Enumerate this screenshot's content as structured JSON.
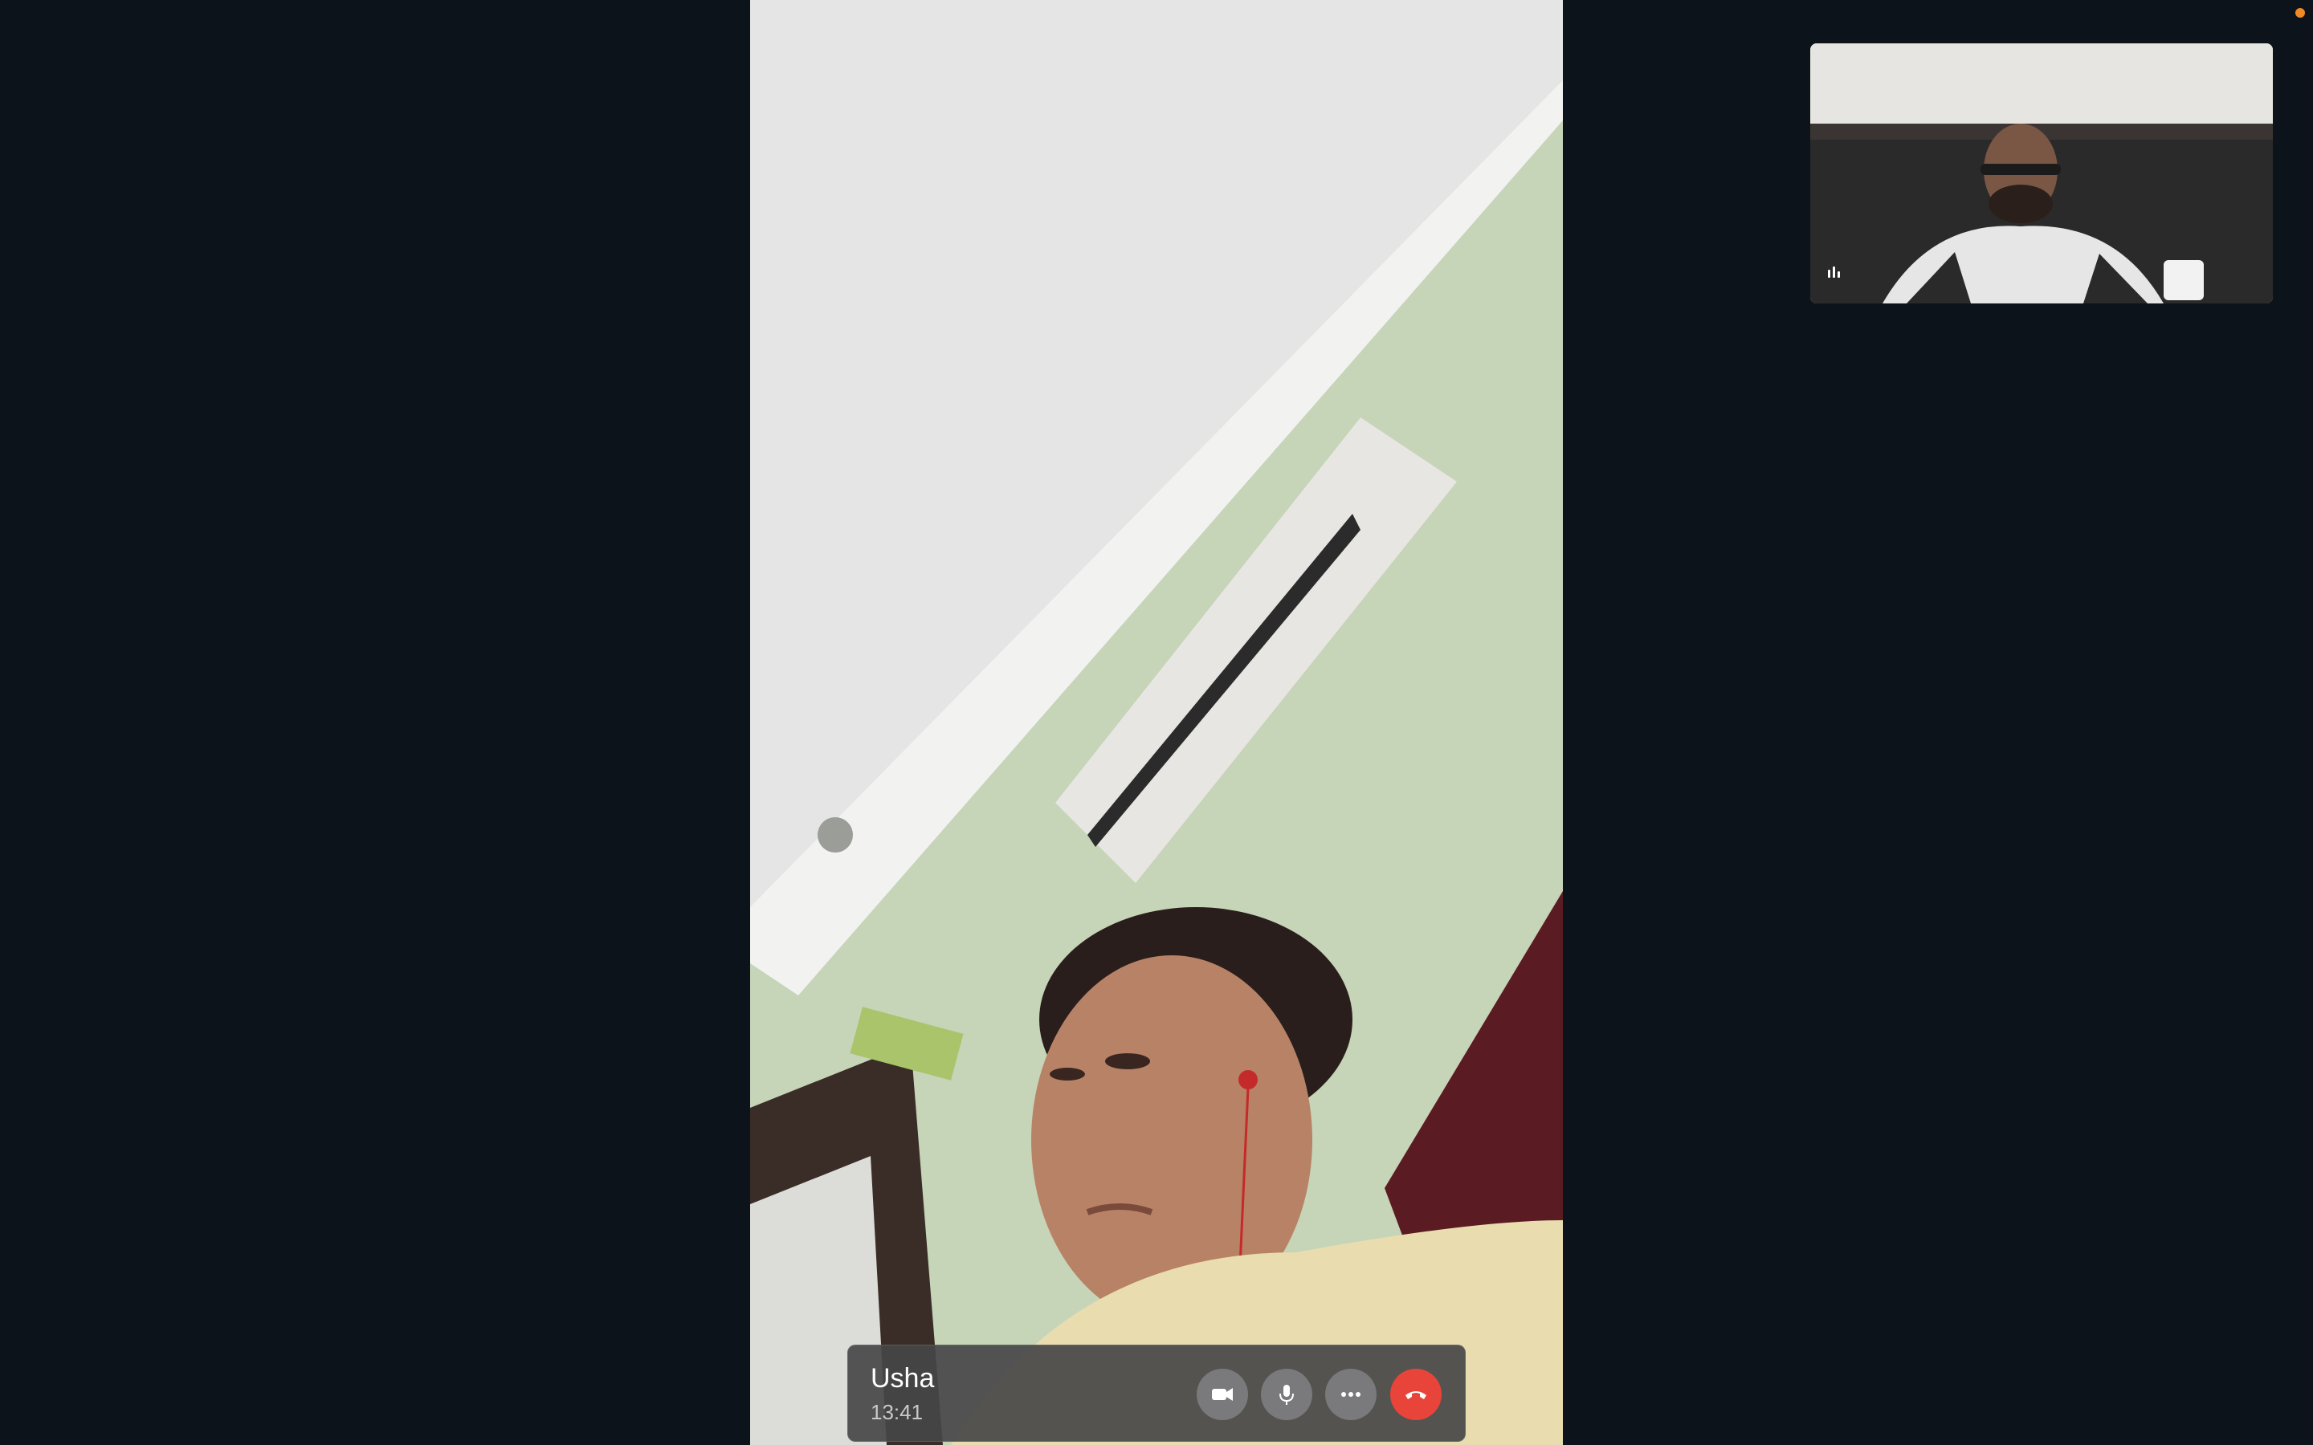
{
  "call": {
    "caller_name": "Usha",
    "duration": "13:41"
  },
  "controls": {
    "video_icon": "video-camera-icon",
    "mic_icon": "microphone-icon",
    "more_icon": "ellipsis-icon",
    "end_icon": "phone-hangup-icon"
  },
  "indicators": {
    "recording_dot_color": "#f08a24",
    "audio_level_icon": "audio-level-icon"
  },
  "colors": {
    "background": "#0c131b",
    "end_call": "#e8443a",
    "control_button": "#7a7a7d"
  }
}
